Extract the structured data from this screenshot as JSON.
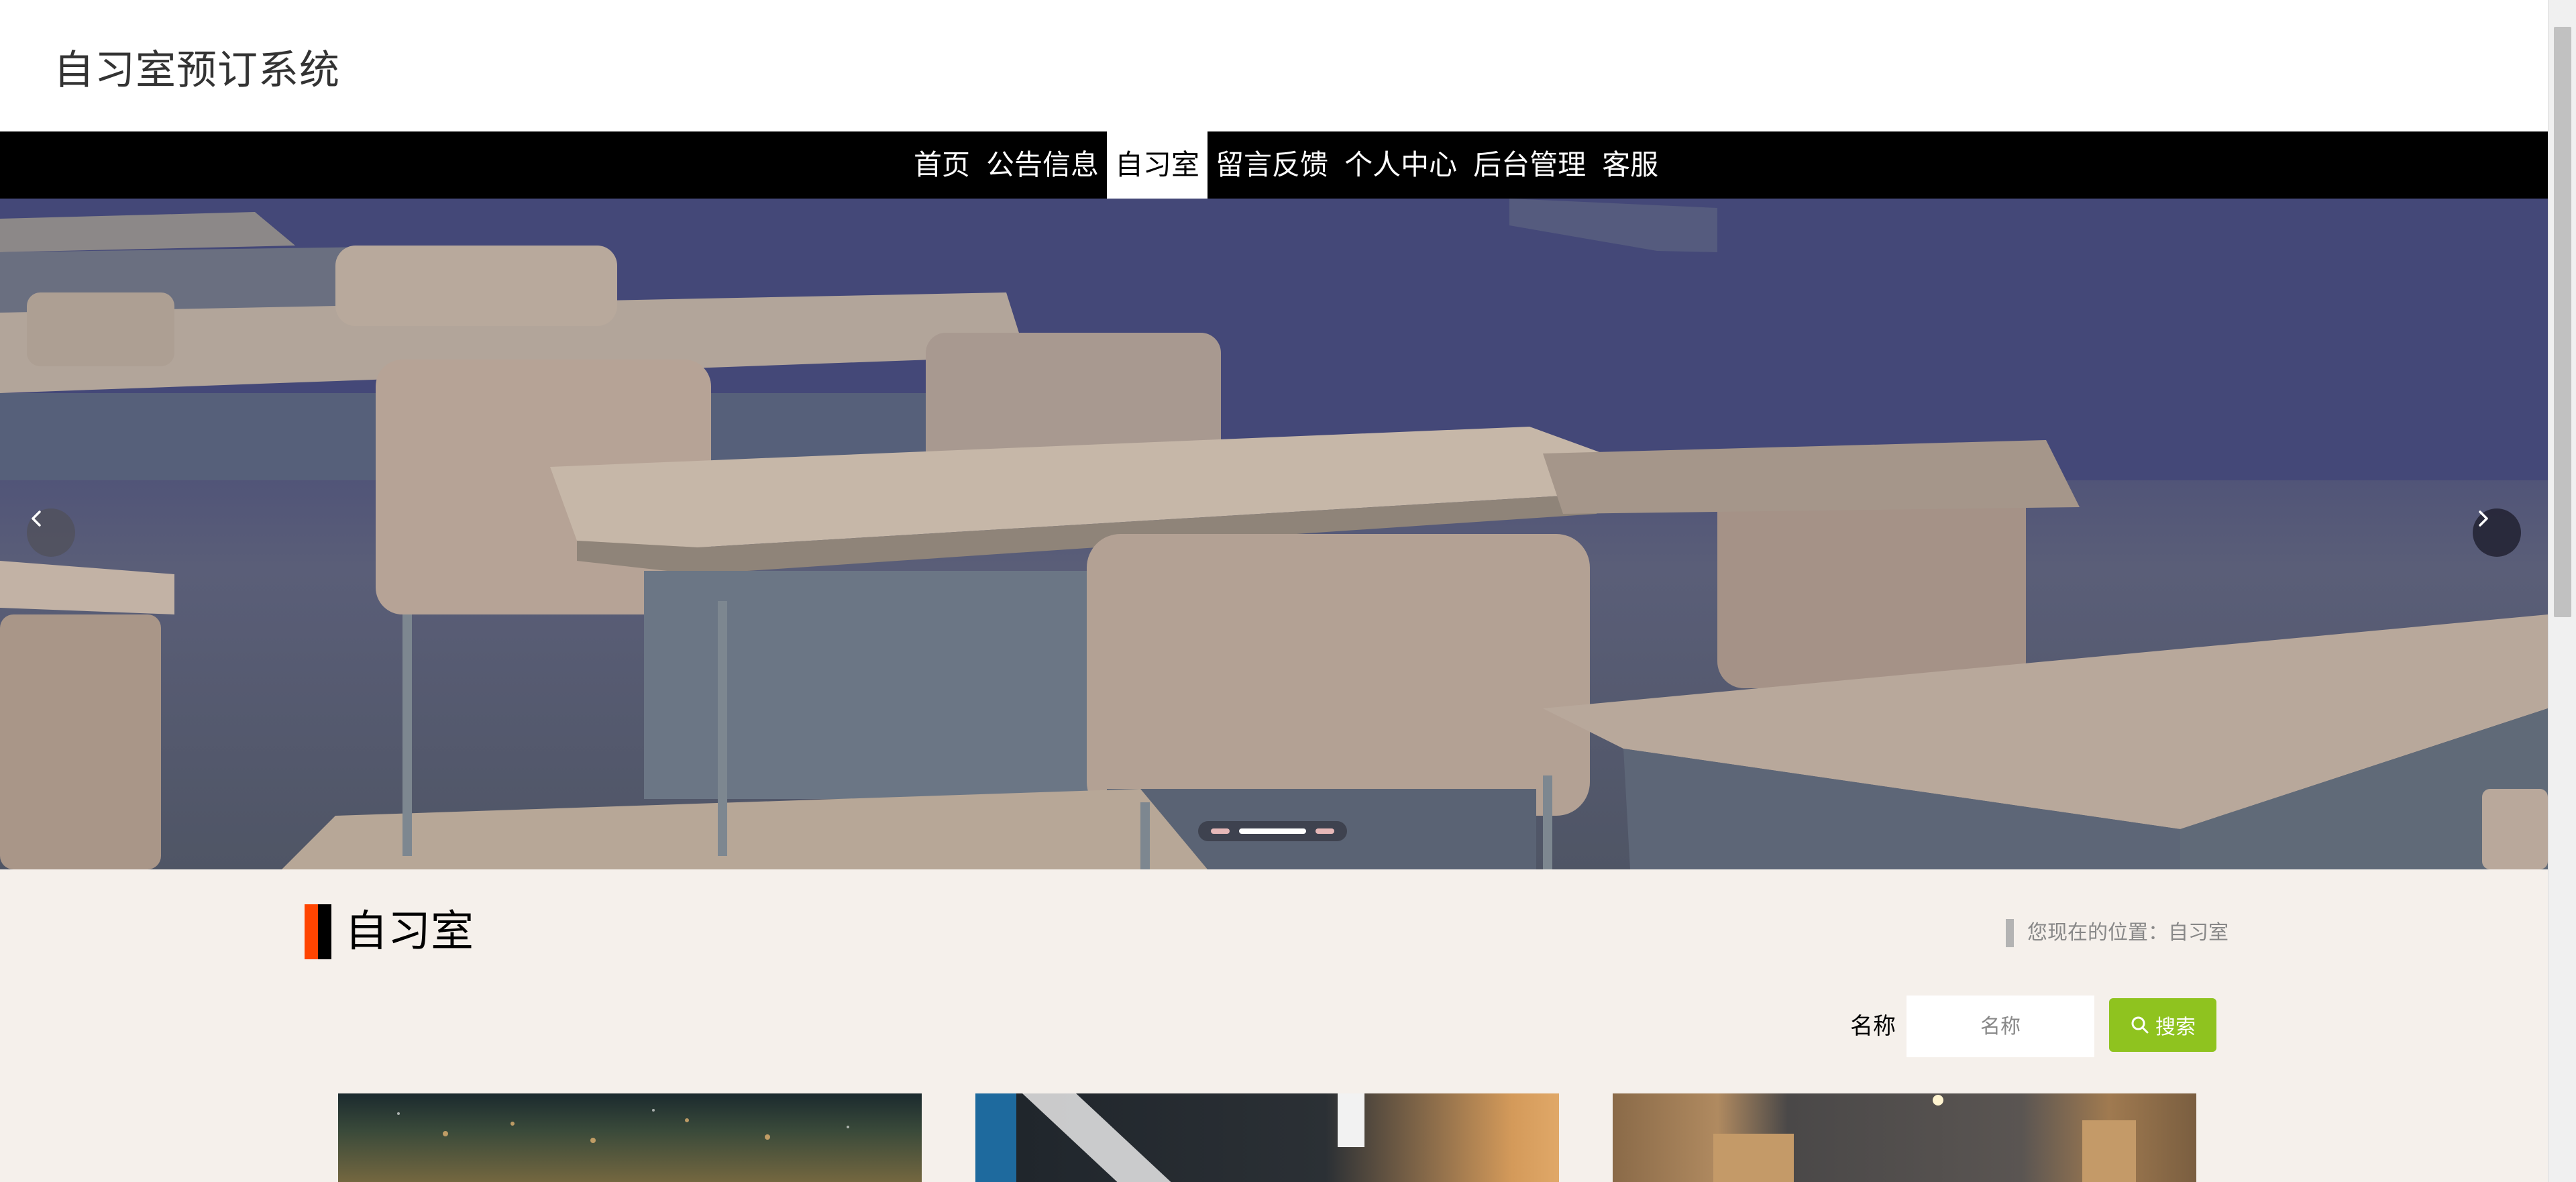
{
  "header": {
    "site_title": "自习室预订系统"
  },
  "nav": {
    "items": [
      {
        "label": "首页"
      },
      {
        "label": "公告信息"
      },
      {
        "label": "自习室",
        "active": true
      },
      {
        "label": "留言反馈"
      },
      {
        "label": "个人中心"
      },
      {
        "label": "后台管理"
      },
      {
        "label": "客服"
      }
    ]
  },
  "banner": {
    "prev_icon": "chevron-left-icon",
    "next_icon": "chevron-right-icon",
    "slide_count": 3,
    "active_slide": 2
  },
  "section": {
    "title": "自习室",
    "breadcrumb": "您现在的位置：自习室"
  },
  "search": {
    "label": "名称",
    "placeholder": "名称",
    "button_label": "搜索",
    "button_icon": "search-icon",
    "button_color": "#8fc31f"
  },
  "colors": {
    "accent": "#ff4400",
    "nav_background": "#000000",
    "page_background": "#f5f0eb"
  },
  "cards": [
    {
      "image": "room-photo-1"
    },
    {
      "image": "room-photo-2"
    },
    {
      "image": "room-photo-3"
    }
  ]
}
